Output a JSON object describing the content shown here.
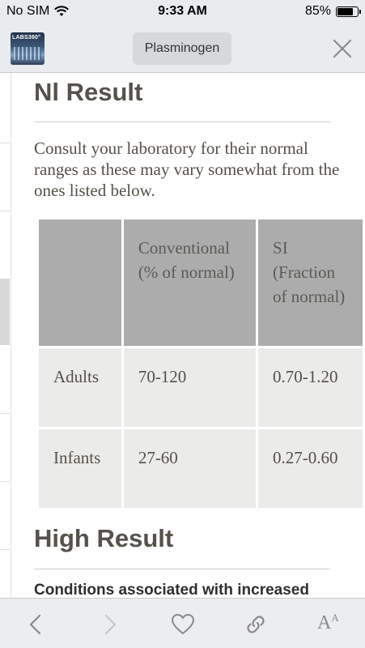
{
  "status_bar": {
    "carrier": "No SIM",
    "time": "9:33 AM",
    "battery": "85%",
    "battery_level": 0.85
  },
  "nav": {
    "logo_text": "LABS360°",
    "title": "Plasminogen"
  },
  "content": {
    "normal_heading": "Nl Result",
    "intro": "Consult your laboratory for their normal ranges as these may vary somewhat from the ones listed below.",
    "table": {
      "headers": [
        "",
        "Conventional (% of normal)",
        "SI (Fraction of normal)"
      ],
      "rows": [
        [
          "Adults",
          "70-120",
          "0.70-1.20"
        ],
        [
          "Infants",
          "27-60",
          "0.27-0.60"
        ]
      ]
    },
    "high_heading": "High Result",
    "conditions_text": "Conditions associated with increased"
  },
  "toolbar": {
    "back_icon": "chevron-left-icon",
    "forward_icon": "chevron-right-icon",
    "favorite_icon": "heart-icon",
    "link_icon": "link-icon",
    "text_size_label": "A",
    "text_size_sup": "A"
  },
  "colors": {
    "heading": "#55524c",
    "header_cell": "#acacac",
    "body_cell": "#ebebe9",
    "bar": "#e9ebee"
  }
}
